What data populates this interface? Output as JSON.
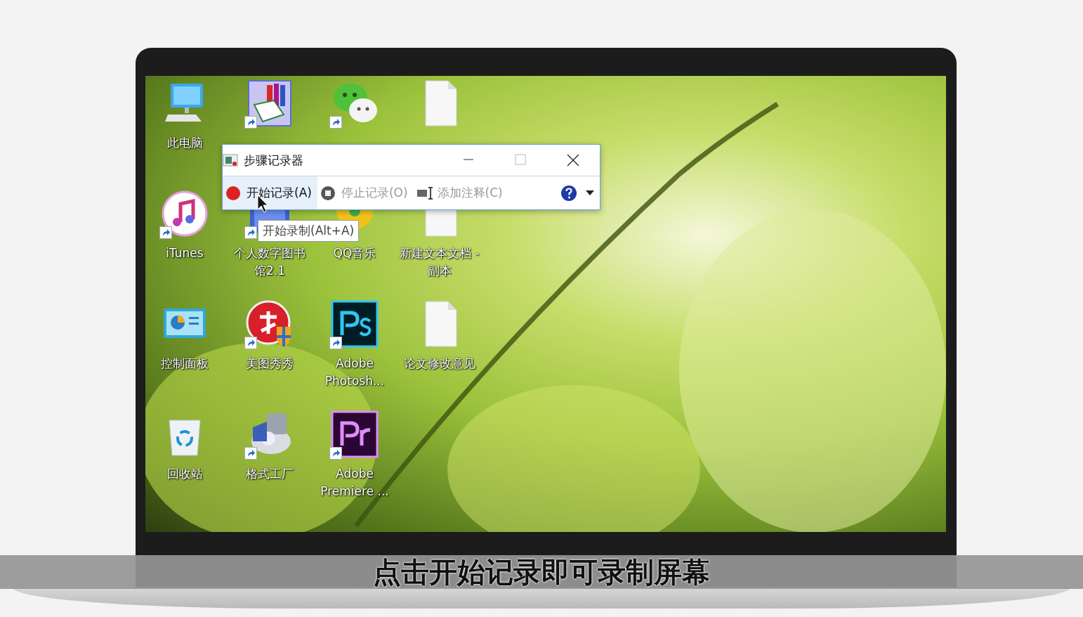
{
  "desktop": {
    "icons": [
      {
        "kind": "computer",
        "label": "此电脑",
        "shortcut": false
      },
      {
        "kind": "reader",
        "shortcut": true
      },
      {
        "kind": "chat",
        "shortcut": true
      },
      {
        "kind": "document",
        "shortcut": false
      },
      {
        "kind": "music",
        "label": "iTunes",
        "shortcut": true
      },
      {
        "kind": "library",
        "label": "个人数字图书馆2.1",
        "shortcut": true
      },
      {
        "kind": "disc",
        "label": "QQ音乐"
      },
      {
        "kind": "document",
        "label": "新建文本文档 - 副本",
        "shortcut": false
      },
      {
        "kind": "panel",
        "label": "控制面板",
        "shortcut": false
      },
      {
        "kind": "badge",
        "label": "美图秀秀",
        "shortcut": true
      },
      {
        "kind": "ps",
        "label": "Adobe Photosh...",
        "shortcut": true
      },
      {
        "kind": "document",
        "label": "论文修改意见",
        "shortcut": false
      },
      {
        "kind": "bin",
        "label": "回收站",
        "shortcut": false
      },
      {
        "kind": "converter",
        "label": "格式工厂",
        "shortcut": true
      },
      {
        "kind": "pr",
        "label": "Adobe Premiere ...",
        "shortcut": true
      }
    ]
  },
  "recorder_window": {
    "title": "步骤记录器",
    "toolbar": [
      {
        "kind": "record",
        "label": "开始记录(A)",
        "highlighted": true,
        "disabled": false
      },
      {
        "kind": "stop",
        "label": "停止记录(O)",
        "highlighted": false,
        "disabled": true
      },
      {
        "kind": "comment",
        "label": "添加注释(C)",
        "highlighted": false,
        "disabled": true
      }
    ],
    "tooltip": "开始录制(Alt+A)"
  },
  "caption": "点击开始记录即可录制屏幕"
}
